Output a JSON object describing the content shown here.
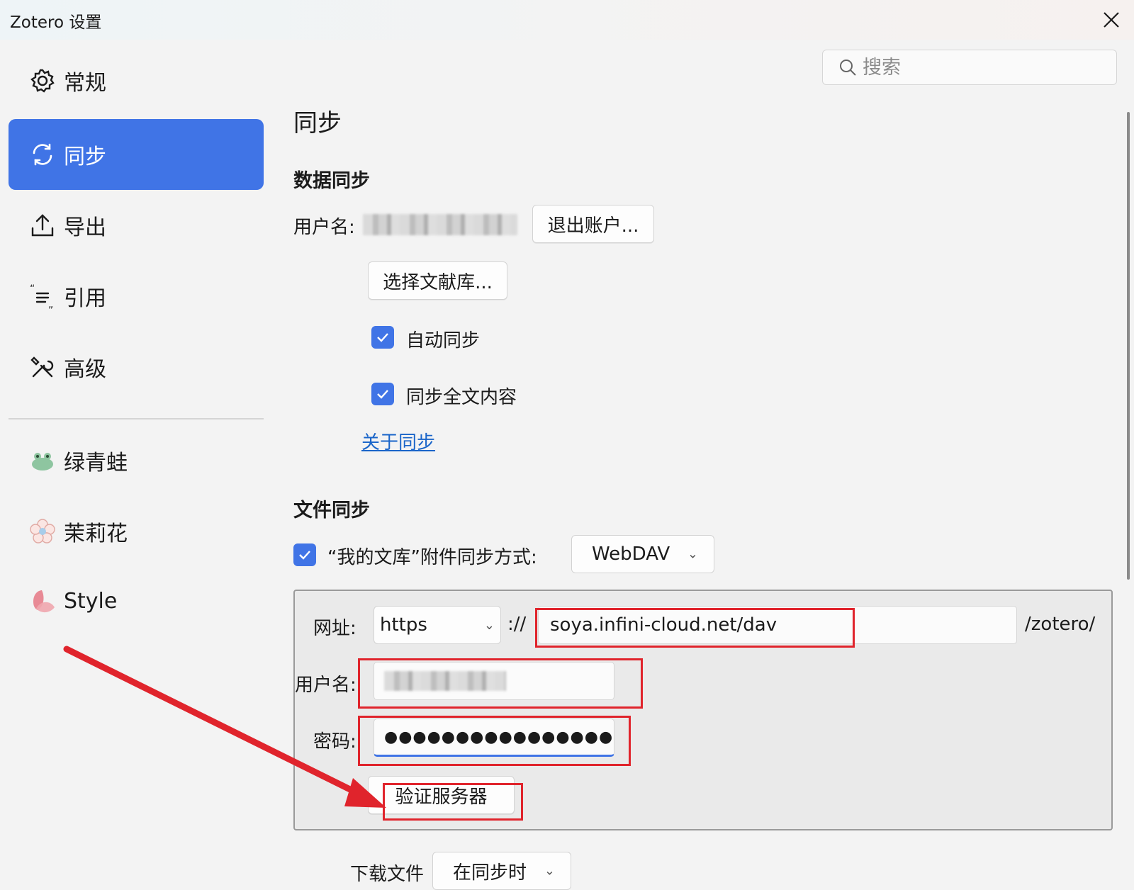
{
  "window": {
    "title": "Zotero 设置"
  },
  "sidebar": {
    "items": [
      {
        "label": "常规",
        "icon": "gear-icon"
      },
      {
        "label": "同步",
        "icon": "sync-icon",
        "selected": true
      },
      {
        "label": "导出",
        "icon": "upload-icon"
      },
      {
        "label": "引用",
        "icon": "quote-icon"
      },
      {
        "label": "高级",
        "icon": "tools-icon"
      },
      {
        "label": "绿青蛙",
        "icon": "frog-icon"
      },
      {
        "label": "茉莉花",
        "icon": "flower-icon"
      },
      {
        "label": "Style",
        "icon": "petal-icon"
      }
    ]
  },
  "search": {
    "placeholder": "搜索"
  },
  "page": {
    "title": "同步",
    "data_sync": {
      "heading": "数据同步",
      "username_label": "用户名:",
      "logout_button": "退出账户...",
      "choose_library_button": "选择文献库...",
      "auto_sync_label": "自动同步",
      "fulltext_sync_label": "同步全文内容",
      "about_link": "关于同步"
    },
    "file_sync": {
      "heading": "文件同步",
      "my_library_label": "“我的文库”附件同步方式:",
      "method_value": "WebDAV",
      "webdav": {
        "url_label": "网址:",
        "protocol_value": "https",
        "protocol_sep": "://",
        "url_value": "soya.infini-cloud.net/dav",
        "url_suffix": "/zotero/",
        "username_label": "用户名:",
        "password_label": "密码:",
        "password_value": "●●●●●●●●●●●●●●●●",
        "verify_button": "验证服务器"
      },
      "download_label": "下载文件",
      "download_value": "在同步时"
    }
  },
  "colors": {
    "accent": "#4074e6",
    "annotation": "#e0242c"
  }
}
